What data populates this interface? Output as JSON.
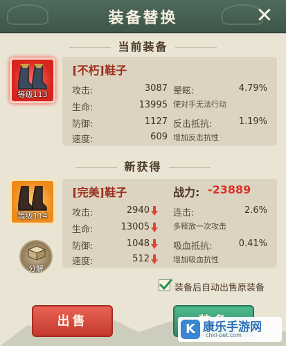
{
  "header": {
    "title": "装备替换",
    "close_glyph": "✕"
  },
  "current": {
    "section_title": "当前装备",
    "level": "等级113",
    "name": "[不朽]鞋子",
    "stats": [
      {
        "label": "攻击:",
        "value": "3087"
      },
      {
        "label": "生命:",
        "value": "13995"
      },
      {
        "label": "防御:",
        "value": "1127"
      },
      {
        "label": "速度:",
        "value": "609"
      }
    ],
    "extras": [
      {
        "label": "晕眩:",
        "value": "4.79%",
        "desc": "使对手无法行动"
      },
      {
        "label": "反击抵抗:",
        "value": "1.19%",
        "desc": "增加反击抗性"
      }
    ]
  },
  "new": {
    "section_title": "新获得",
    "level": "等级114",
    "name": "[完美]鞋子",
    "power_label": "战力:",
    "power_value": "-23889",
    "stats": [
      {
        "label": "攻击:",
        "value": "2940",
        "trend": "down"
      },
      {
        "label": "生命:",
        "value": "13005",
        "trend": "down"
      },
      {
        "label": "防御:",
        "value": "1048",
        "trend": "down"
      },
      {
        "label": "速度:",
        "value": "512",
        "trend": "down"
      }
    ],
    "extras": [
      {
        "label": "连击:",
        "value": "2.6%",
        "desc": "多释放一次攻击"
      },
      {
        "label": "吸血抵抗:",
        "value": "0.41%",
        "desc": "增加吸血抗性"
      }
    ]
  },
  "decompose_label": "分解",
  "auto_sell": {
    "checked": true,
    "label": "装备后自动出售原装备"
  },
  "buttons": {
    "sell": "出售",
    "equip": "装备"
  },
  "watermark": {
    "title": "康乐手游网",
    "sub": "chkl-pet.com"
  },
  "colors": {
    "accent_red": "#d9332a",
    "header": "#4f6a5c",
    "down_arrow": "#e0443a"
  }
}
